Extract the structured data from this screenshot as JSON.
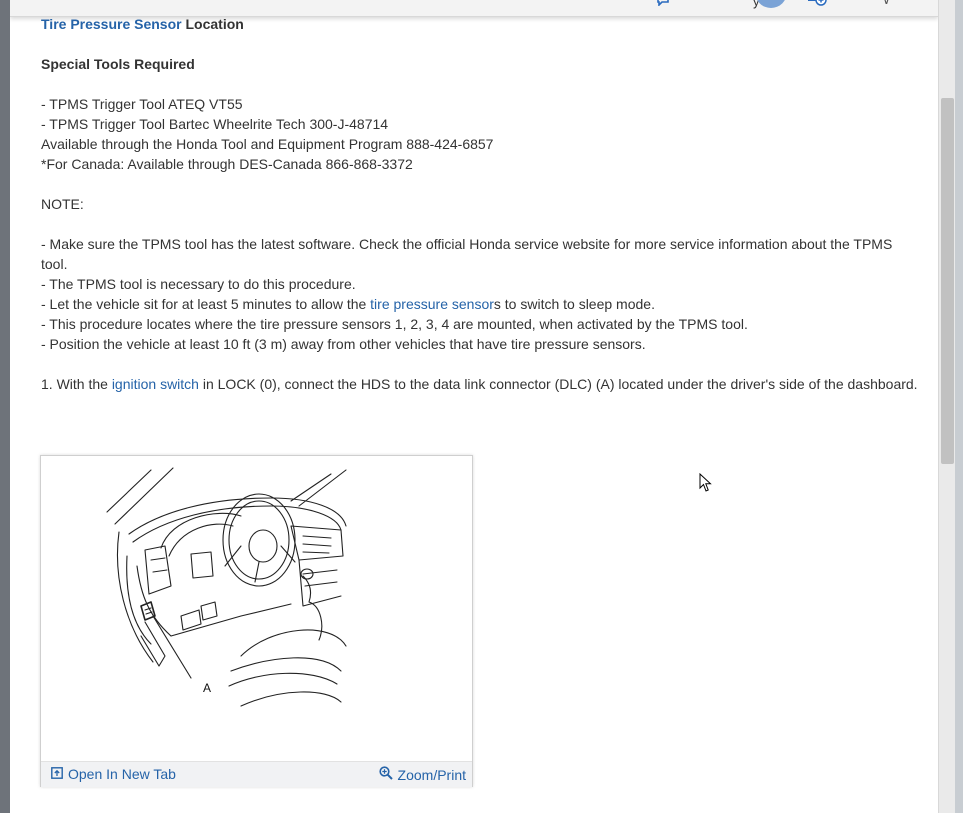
{
  "toolbar": {
    "partial_char": "y",
    "more_char": "∨"
  },
  "content": {
    "heading_link": "Tire Pressure Sensor",
    "heading_rest": " Location",
    "special_tools_title": "Special Tools Required",
    "tools": [
      " -  TPMS Trigger Tool ATEQ VT55",
      " -  TPMS Trigger Tool Bartec Wheelrite Tech 300-J-48714"
    ],
    "availability": "Available through the Honda Tool and Equipment Program 888-424-6857",
    "canada": "*For Canada: Available through DES-Canada 866-868-3372",
    "note_title": "NOTE:",
    "note_1": " -  Make sure the TPMS tool has the latest software. Check the official Honda service website for more service information about the TPMS tool.",
    "note_2": " -  The TPMS tool is necessary to do this procedure.",
    "note_3_pre": " -  Let the vehicle sit for at least 5 minutes to allow the ",
    "note_3_link": "tire pressure sensor",
    "note_3_post": "s to switch to sleep mode.",
    "note_4": " -  This procedure locates where the tire pressure sensors 1, 2, 3, 4 are mounted, when activated by the TPMS tool.",
    "note_5": " -  Position the vehicle at least 10 ft (3 m) away from other vehicles that have tire pressure sensors.",
    "step_pre": " 1. With the ",
    "step_link": "ignition switch",
    "step_post": " in LOCK (0), connect the HDS to the data link connector (DLC) (A) located under the driver's side of the dashboard."
  },
  "figure": {
    "callout": "A",
    "open_label": "Open In New Tab",
    "zoom_label": "Zoom/Print"
  },
  "icons": {
    "open": "open-in-new-tab-icon",
    "zoom": "zoom-icon"
  }
}
